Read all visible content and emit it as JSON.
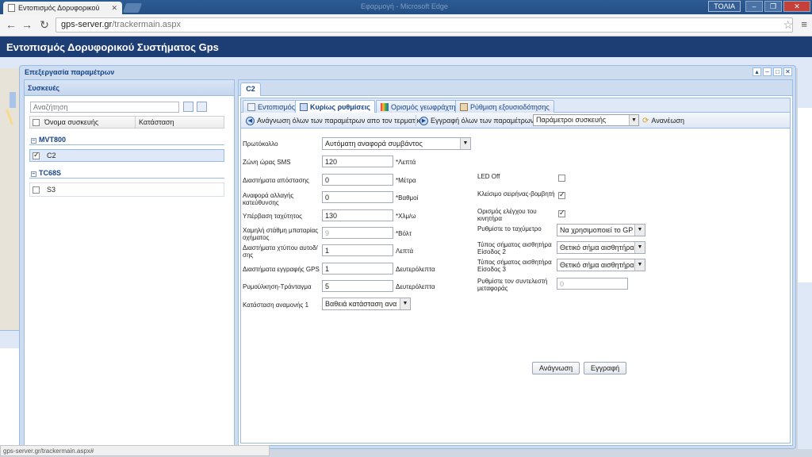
{
  "browser": {
    "tab_title": "Εντοπισμός Δορυφορικού",
    "faded_title": "Εφαρμογή - Microsoft Edge",
    "user_badge": "ΤΟΛΙΑ",
    "url_host": "gps-server.gr",
    "url_path": "/trackermain.aspx",
    "status_text": "gps-server.gr/trackermain.aspx#"
  },
  "app": {
    "title": "Εντοπισμός Δορυφορικού Συστήματος Gps"
  },
  "dialog": {
    "title": "Επεξεργασία παραμέτρων",
    "devices": {
      "header": "Συσκευές",
      "search_placeholder": "Αναζήτηση",
      "col_name": "Όνομα συσκευής",
      "col_status": "Κατάσταση",
      "groups": [
        {
          "name": "MVT800",
          "items": [
            "C2"
          ]
        },
        {
          "name": "TC68S",
          "items": [
            "S3"
          ]
        }
      ]
    },
    "device_tab": "C2",
    "subtabs": [
      "Εντοπισμός",
      "Κυρίως ρυθμίσεις",
      "Ορισμός γεωφράχτη",
      "Ρύθμιση εξουσιοδότησης"
    ],
    "toolbar": {
      "read_all": "Ανάγνωση όλων των παραμέτρων απο τον τερματικό",
      "write_all": "Εγγραφή όλων των παραμέτρων",
      "params_select": "Παράμετροι συσκευής",
      "refresh": "Ανανέωση"
    },
    "form": {
      "protocol_label": "Πρωτόκολλο",
      "protocol_value": "Αυτόματη αναφορά συμβάντος",
      "tz_label": "Ζώνη ώρας SMS",
      "tz_value": "120",
      "tz_unit": "*Λεπτά",
      "dist_label": "Διαστήματα απόστασης",
      "dist_value": "0",
      "dist_unit": "*Μέτρα",
      "heading_label": "Αναφορά αλλαγής κατεύθυνσης",
      "heading_value": "0",
      "heading_unit": "*Βαθμοί",
      "speed_label": "Υπέρβαση ταχύτητος",
      "speed_value": "130",
      "speed_unit": "*Χλμ/ω",
      "battery_label": "Χαμηλή στάθμη μπαταρίας οχήματος",
      "battery_value": "9",
      "battery_unit": "*Βόλτ",
      "shock_label": "Διαστήματα χτύπου αυτοδ/σης",
      "shock_value": "1",
      "shock_unit": "Λεπτά",
      "gps_label": "Διαστήματα εγγραφής GPS",
      "gps_value": "1",
      "gps_unit": "Δευτερόλεπτα",
      "vib_label": "Ρυμούλκηση-Τράνταγμα",
      "vib_value": "5",
      "vib_unit": "Δευτερόλεπτα",
      "standby_label": "Κατάσταση αναμονής 1",
      "standby_value": "Βαθειά κατάσταση ανα",
      "led_label": "LED Off",
      "siren_label": "Κλείσιμο σειρήνας-βομβητή",
      "engine_label": "Ορισμός ελέγχου του κινητήρα",
      "odometer_label": "Ρυθμίστε το ταχύμετρο",
      "odometer_value": "Να χρησιμοποιεί το GP",
      "in2_label": "Τύπος σήματος αισθητήρα Είσοδος 2",
      "in2_value": "Θετικό σήμα αισθητήρα",
      "in3_label": "Τύπος σήματος αισθητήρα Είσοδος 3",
      "in3_value": "Θετικό σήμα αισθητήρα",
      "factor_label": "Ρυθμίστε τον συντελεστή μεταφοράς",
      "factor_value": "0",
      "read_btn": "Ανάγνωση",
      "save_btn": "Εγγραφή"
    },
    "checkbox_states": {
      "led_off": false,
      "siren": true,
      "engine": true,
      "device_c2": true,
      "device_s3": false
    }
  }
}
